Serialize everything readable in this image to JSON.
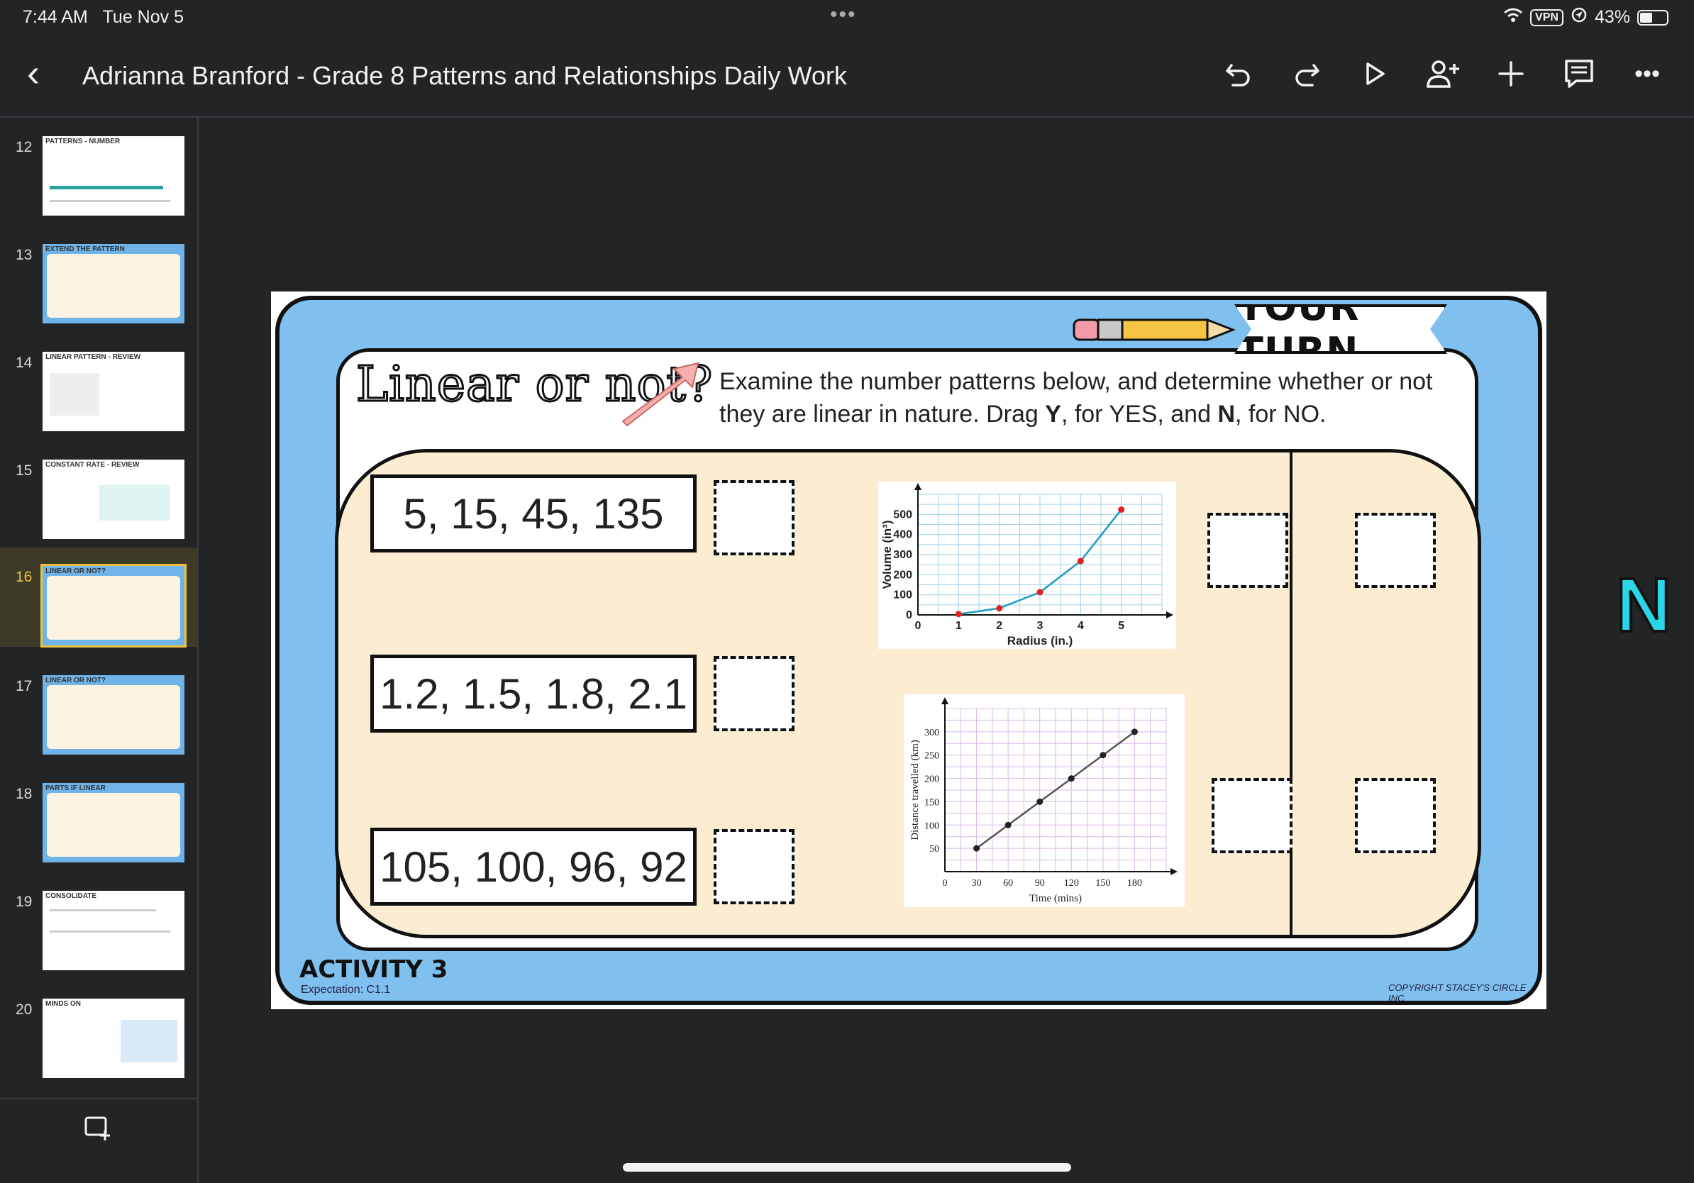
{
  "status": {
    "time": "7:44 AM",
    "date": "Tue Nov 5",
    "vpn": "VPN",
    "battery": "43%"
  },
  "header": {
    "title": "Adrianna Branford - Grade 8 Patterns and Relationships Daily Work"
  },
  "sidebar": {
    "slides": [
      {
        "num": "12",
        "label": "PATTERNS - NUMBER"
      },
      {
        "num": "13",
        "label": "EXTEND THE PATTERN"
      },
      {
        "num": "14",
        "label": "LINEAR PATTERN - REVIEW"
      },
      {
        "num": "15",
        "label": "CONSTANT RATE - REVIEW"
      },
      {
        "num": "16",
        "label": "LINEAR OR NOT?"
      },
      {
        "num": "17",
        "label": "LINEAR OR NOT?"
      },
      {
        "num": "18",
        "label": "PARTS IF LINEAR"
      },
      {
        "num": "19",
        "label": "CONSOLIDATE"
      },
      {
        "num": "20",
        "label": "MINDS ON"
      }
    ]
  },
  "slide": {
    "badge": "YOUR TURN",
    "title": "Linear or not?",
    "instructions_a": "Examine the number patterns below, and determine whether or not they are linear in nature. Drag ",
    "y": "Y",
    "instructions_b": ", for YES, and ",
    "n": "N",
    "instructions_c": ", for NO.",
    "sequences": [
      "5, 15, 45, 135",
      "1.2, 1.5, 1.8, 2.1",
      "105, 100, 96, 92"
    ],
    "activity": "ACTIVITY 3",
    "expectation": "Expectation:  C1.1",
    "copyright": "COPYRIGHT STACEY'S CIRCLE INC.",
    "overflow_letter": "N"
  },
  "chart_data": [
    {
      "type": "line",
      "x": [
        1,
        2,
        3,
        4,
        5
      ],
      "y": [
        4,
        33,
        113,
        268,
        524
      ],
      "xlabel": "Radius (in.)",
      "ylabel": "Volume (in³)",
      "xticks": [
        "0",
        "1",
        "2",
        "3",
        "4",
        "5"
      ],
      "yticks": [
        "0",
        "100",
        "200",
        "300",
        "400",
        "500"
      ],
      "xlim": [
        0,
        6
      ],
      "ylim": [
        0,
        600
      ],
      "color": "#1a9cc4",
      "point_color": "#e62020"
    },
    {
      "type": "line",
      "x": [
        30,
        60,
        90,
        120,
        150,
        180
      ],
      "y": [
        50,
        100,
        150,
        200,
        250,
        300
      ],
      "xlabel": "Time (mins)",
      "ylabel": "Distance travelled (km)",
      "xticks": [
        "0",
        "30",
        "60",
        "90",
        "120",
        "150",
        "180"
      ],
      "yticks": [
        "50",
        "100",
        "150",
        "200",
        "250",
        "300"
      ],
      "xlim": [
        0,
        210
      ],
      "ylim": [
        0,
        350
      ],
      "color": "#555555",
      "point_color": "#222222"
    }
  ]
}
